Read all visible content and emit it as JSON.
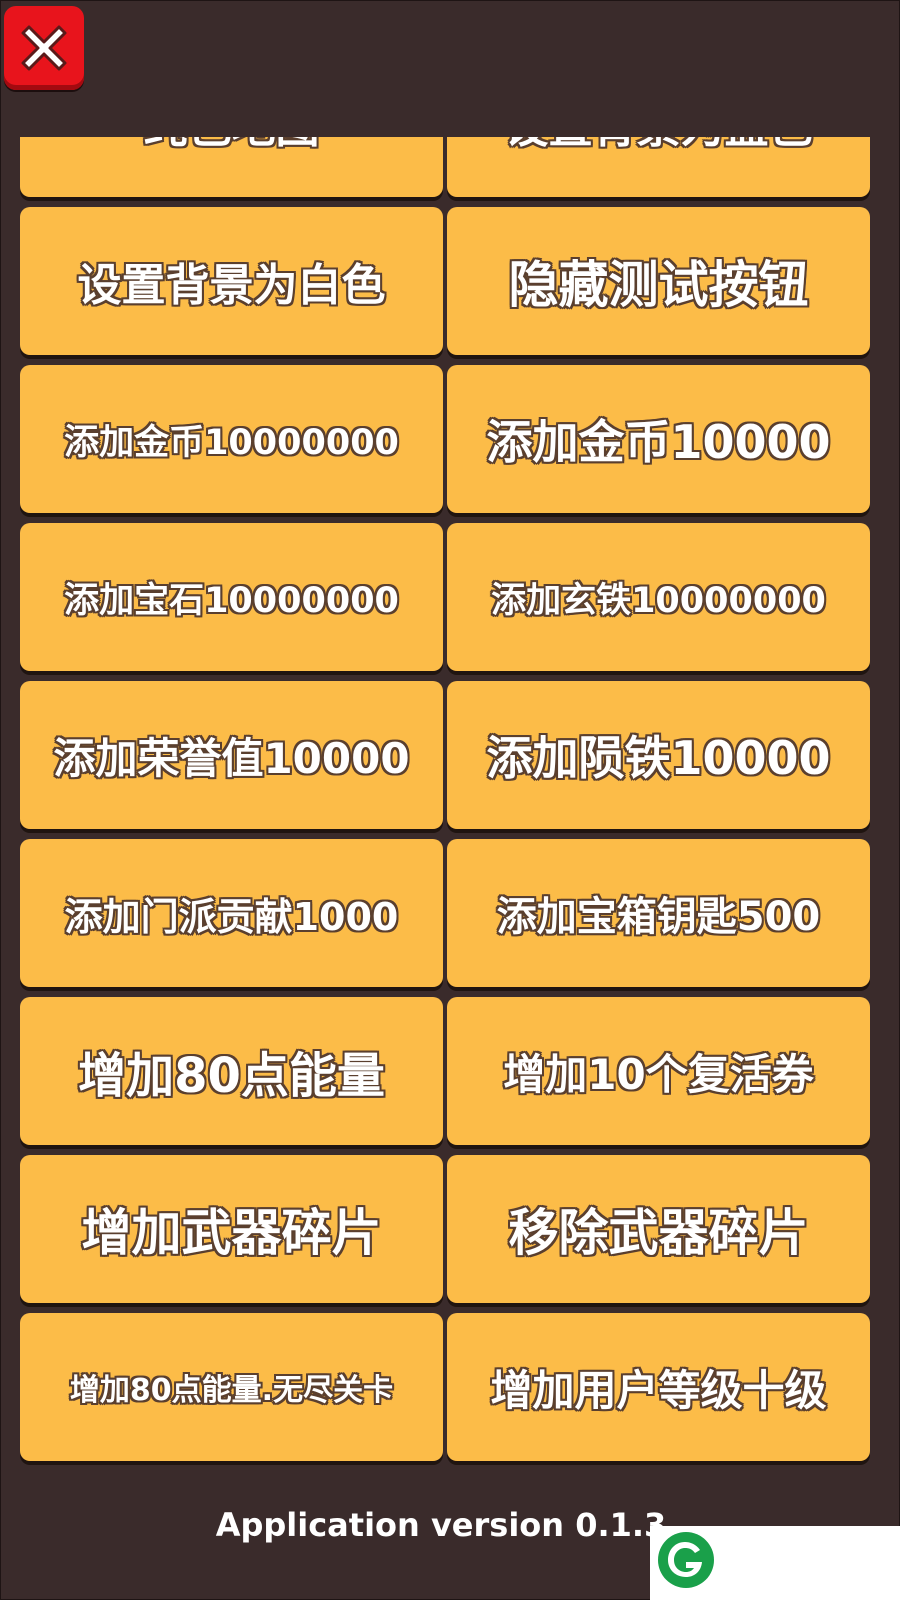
{
  "close_button": {
    "icon": "close-x-icon"
  },
  "buttons": [
    {
      "label": "纯色地图",
      "size": 44
    },
    {
      "label": "设置背景为蓝色",
      "size": 44
    },
    {
      "label": "设置背景为白色",
      "size": 44
    },
    {
      "label": "隐藏测试按钮",
      "size": 50
    },
    {
      "label": "添加金币10000000",
      "size": 35
    },
    {
      "label": "添加金币10000",
      "size": 46
    },
    {
      "label": "添加宝石10000000",
      "size": 35
    },
    {
      "label": "添加玄铁10000000",
      "size": 35
    },
    {
      "label": "添加荣誉值10000",
      "size": 42
    },
    {
      "label": "添加陨铁10000",
      "size": 46
    },
    {
      "label": "添加门派贡献1000",
      "size": 38
    },
    {
      "label": "添加宝箱钥匙500",
      "size": 40
    },
    {
      "label": "增加80点能量",
      "size": 48
    },
    {
      "label": "增加10个复活券",
      "size": 42
    },
    {
      "label": "增加武器碎片",
      "size": 50
    },
    {
      "label": "移除武器碎片",
      "size": 50
    },
    {
      "label": "增加80点能量.无尽关卡",
      "size": 30
    },
    {
      "label": "增加用户等级十级",
      "size": 42
    }
  ],
  "footer": {
    "version_text": "Application version 0.1.3"
  },
  "watermark": {
    "icon": "green-g-logo-icon"
  },
  "colors": {
    "background": "#3a2b2b",
    "button": "#fcbc48",
    "close": "#e8141c",
    "logo": "#1aa04a"
  }
}
